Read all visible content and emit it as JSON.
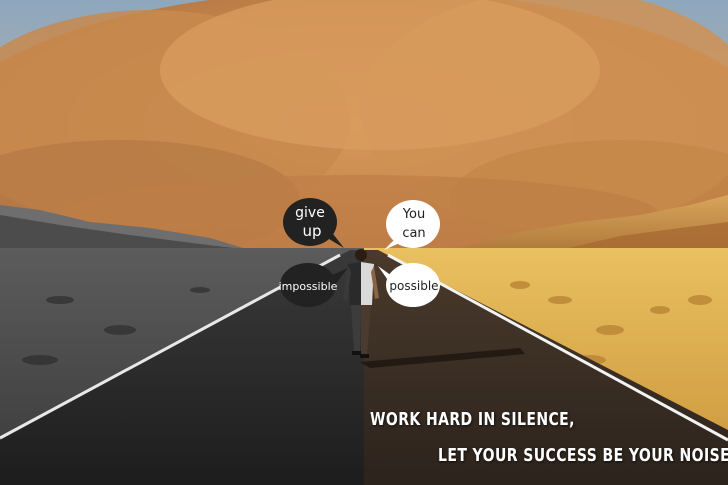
{
  "bubbles": {
    "give_up": {
      "line1": "give",
      "line2": "up"
    },
    "you_can": {
      "line1": "You",
      "line2": "can"
    },
    "impossible": {
      "text": "impossible"
    },
    "possible": {
      "text": "possible"
    }
  },
  "quote": {
    "line1": "WORK HARD IN SILENCE,",
    "line2": "LET YOUR SUCCESS BE YOUR NOISE."
  },
  "colors": {
    "dust_storm": "#c98a4a",
    "sky": "#9fb7c9",
    "desert_gold": "#e2b34a",
    "asphalt_dark": "#2a2a2a",
    "asphalt_warm": "#3a2c22",
    "bubble_dark": "#222222",
    "bubble_light": "#ffffff"
  }
}
